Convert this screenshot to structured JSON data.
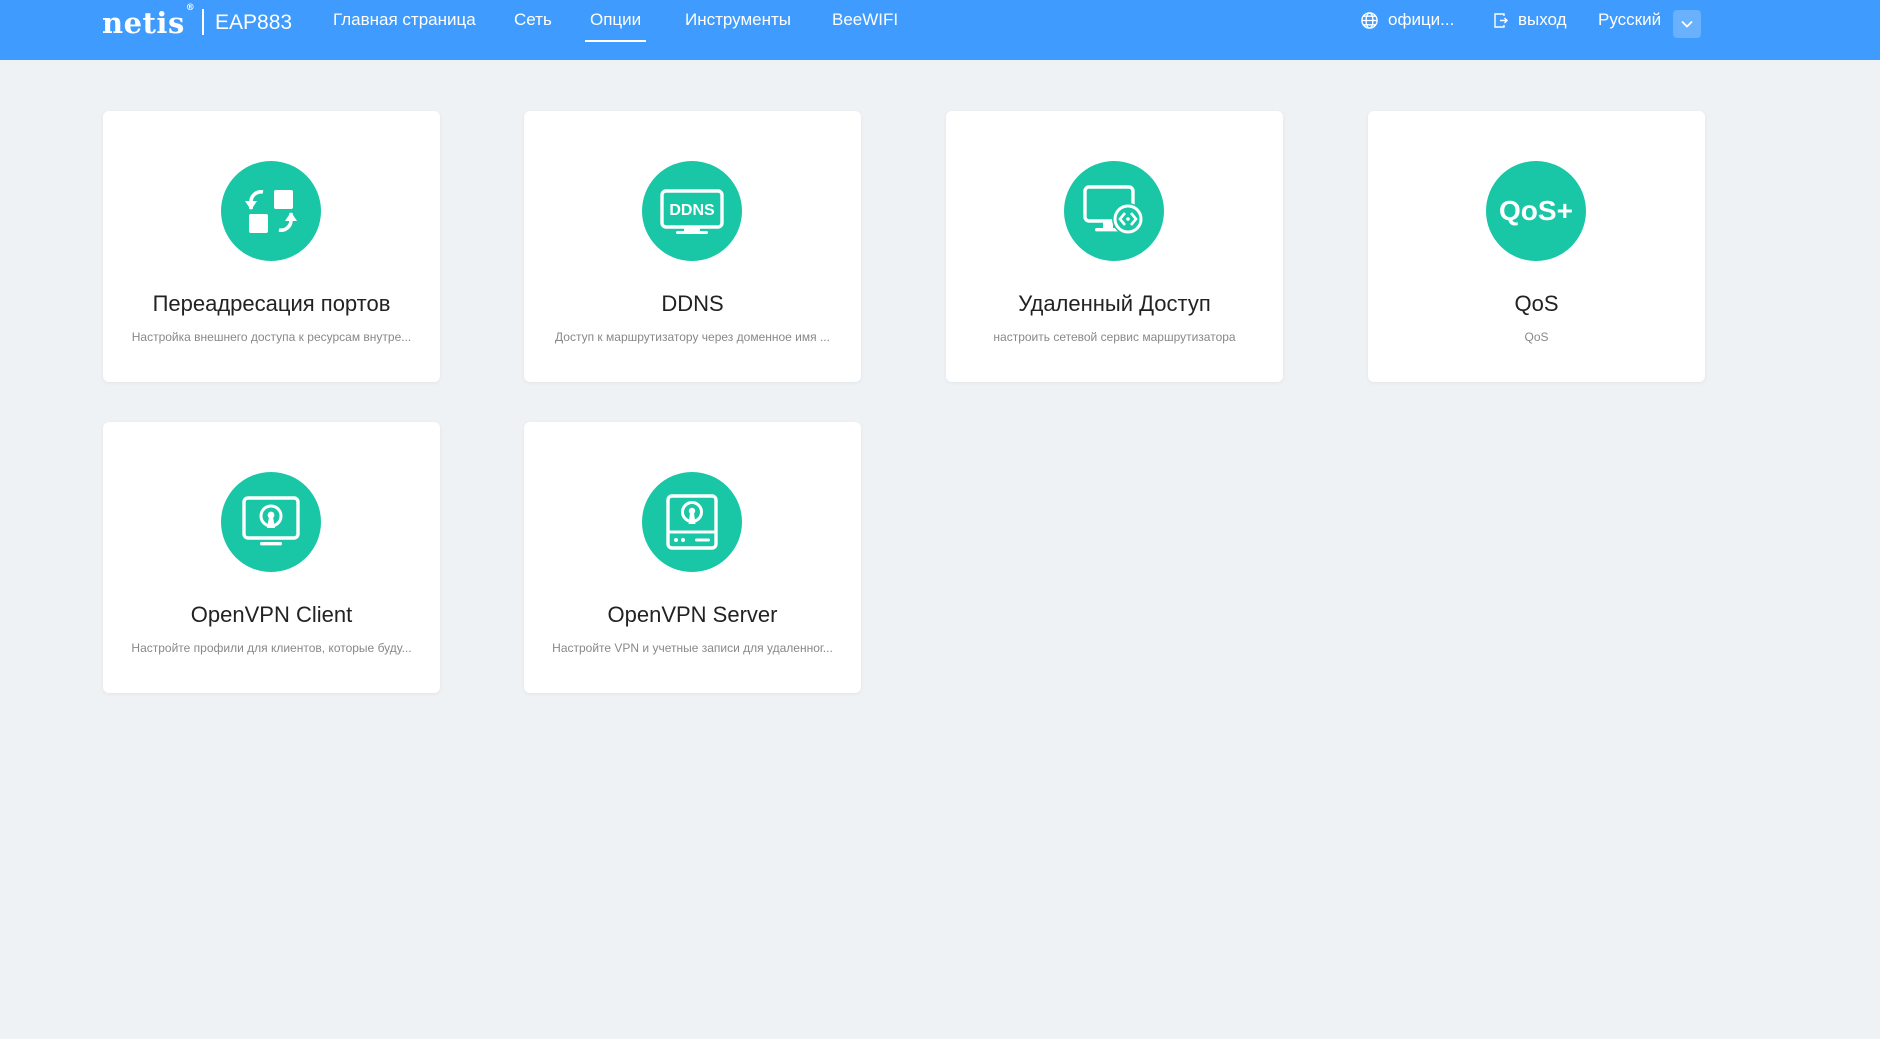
{
  "header": {
    "brand": "netis",
    "brand_mark": "®",
    "model": "EAP883",
    "nav": [
      {
        "label": "Главная страница"
      },
      {
        "label": "Сеть"
      },
      {
        "label": "Опции",
        "active": true
      },
      {
        "label": "Инструменты"
      },
      {
        "label": "BeeWIFI"
      }
    ],
    "official_label": "офици...",
    "logout_label": "выход",
    "language": "Русский",
    "colors": {
      "bar": "#3f9bfd",
      "accent": "#19c6a5"
    }
  },
  "cards": [
    {
      "title": "Переадресация портов",
      "desc": "Настройка внешнего доступа к ресурсам внутре...",
      "icon": "port-forwarding-icon"
    },
    {
      "title": "DDNS",
      "desc": "Доступ к маршрутизатору через доменное имя ...",
      "icon": "ddns-icon",
      "icon_text": "DDNS"
    },
    {
      "title": "Удаленный Доступ",
      "desc": "настроить сетевой сервис маршрутизатора",
      "icon": "remote-access-icon"
    },
    {
      "title": "QoS",
      "desc": "QoS",
      "icon": "qos-icon",
      "icon_text": "QoS+"
    },
    {
      "title": "OpenVPN Client",
      "desc": "Настройте профили для клиентов, которые буду...",
      "icon": "openvpn-client-icon"
    },
    {
      "title": "OpenVPN Server",
      "desc": "Настройте VPN и учетные записи для удаленног...",
      "icon": "openvpn-server-icon"
    }
  ]
}
